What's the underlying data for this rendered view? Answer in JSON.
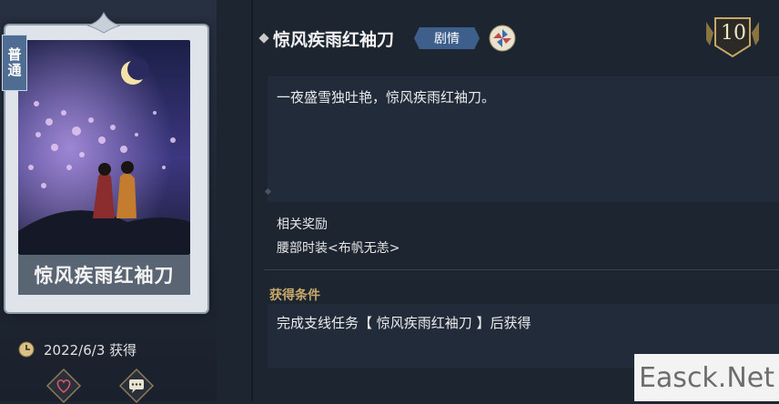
{
  "card": {
    "rarity": "普通",
    "title": "惊风疾雨红袖刀"
  },
  "acquired": {
    "date_text": "2022/6/3  获得"
  },
  "detail": {
    "title": "惊风疾雨红袖刀",
    "tag": "剧情",
    "level": "10",
    "description": "一夜盛雪独吐艳，惊风疾雨红袖刀。",
    "reward_label": "相关奖励",
    "reward_value": "腰部时装<布帆无恙>",
    "condition_label": "获得条件",
    "condition_text": "完成支线任务【 惊风疾雨红袖刀 】后获得"
  },
  "watermark": "Easck.Net",
  "icons": {
    "clock": "clock-icon",
    "heart": "heart-icon",
    "chat": "chat-icon",
    "pinwheel": "pinwheel-icon",
    "level_shield": "level-shield-icon"
  },
  "colors": {
    "background": "#1d2531",
    "badge_blue": "#3e5f8c",
    "condition_gold": "#c9a96a"
  }
}
